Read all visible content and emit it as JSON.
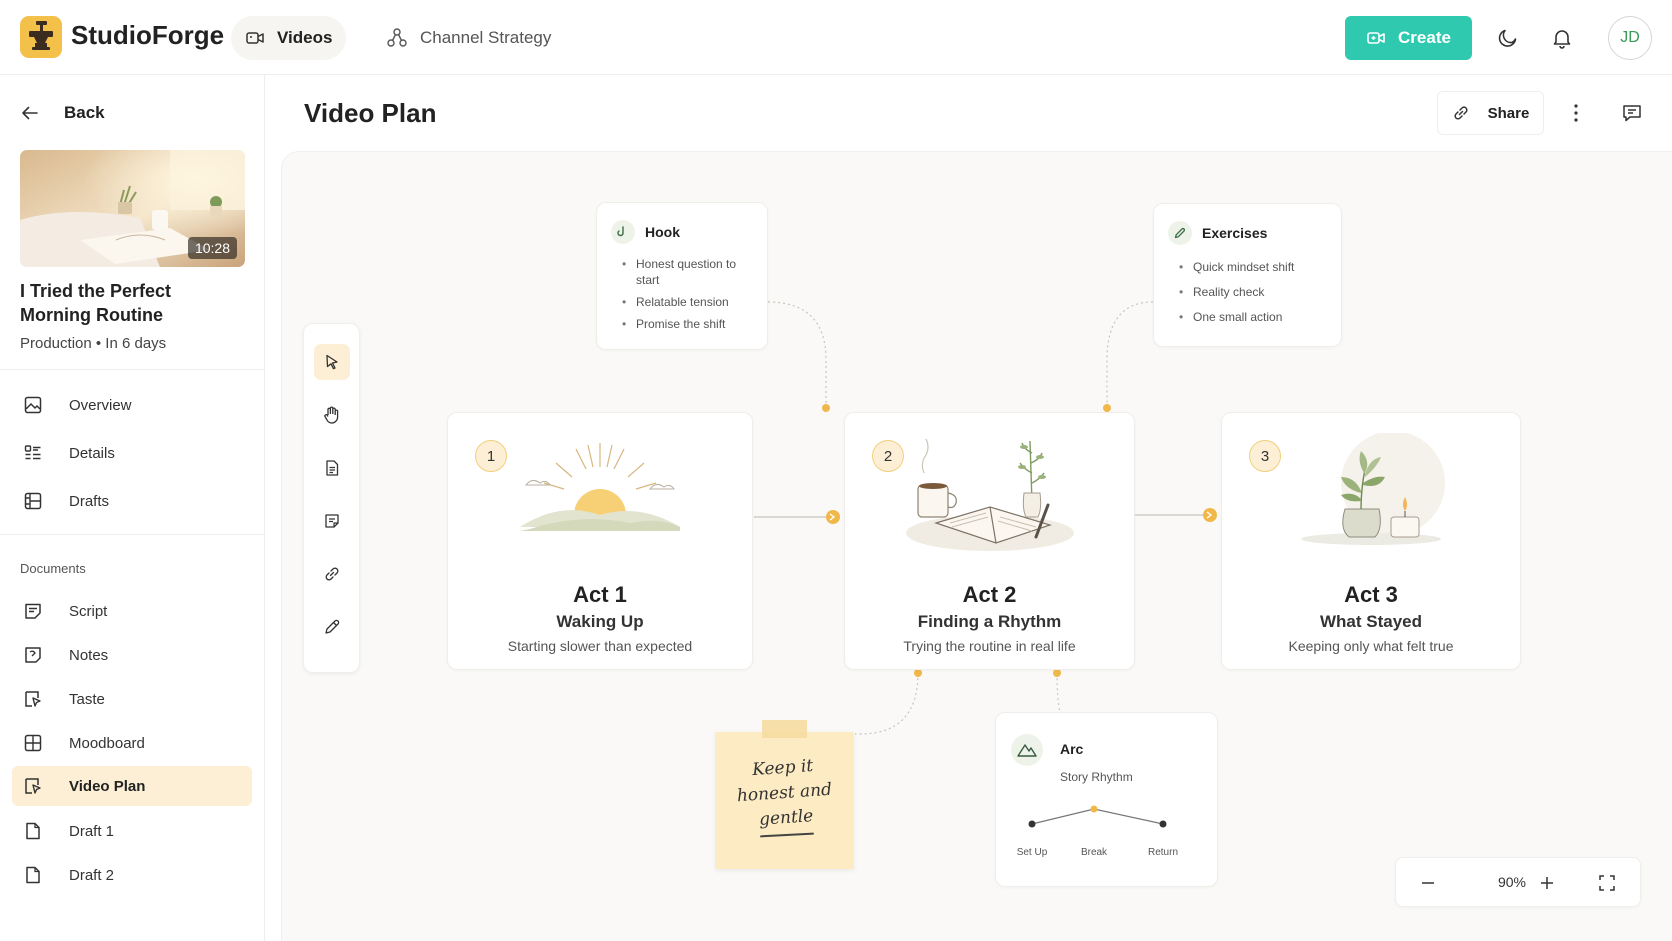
{
  "app": {
    "name": "StudioForge"
  },
  "topnav": {
    "tabs": [
      {
        "label": "Videos",
        "icon": "video-icon"
      },
      {
        "label": "Channel Strategy",
        "icon": "nodes-icon"
      }
    ],
    "create_label": "Create",
    "avatar_initials": "JD"
  },
  "sidebar": {
    "back_label": "Back",
    "video": {
      "title": "I Tried the Perfect Morning Routine",
      "status": "Production • In 6 days",
      "duration": "10:28"
    },
    "main_items": [
      {
        "label": "Overview",
        "icon": "image-icon"
      },
      {
        "label": "Details",
        "icon": "list-icon"
      },
      {
        "label": "Drafts",
        "icon": "film-icon"
      }
    ],
    "documents_label": "Documents",
    "documents": [
      {
        "label": "Script",
        "icon": "script-icon"
      },
      {
        "label": "Notes",
        "icon": "notes-icon"
      },
      {
        "label": "Taste",
        "icon": "taste-icon"
      },
      {
        "label": "Moodboard",
        "icon": "grid-icon"
      },
      {
        "label": "Video Plan",
        "icon": "plan-icon",
        "active": true
      },
      {
        "label": "Draft 1",
        "icon": "file-icon"
      },
      {
        "label": "Draft 2",
        "icon": "file-icon"
      }
    ]
  },
  "main": {
    "title": "Video Plan",
    "share_label": "Share"
  },
  "canvas": {
    "hook": {
      "title": "Hook",
      "items": [
        "Honest question to start",
        "Relatable tension",
        "Promise the shift"
      ]
    },
    "exercises": {
      "title": "Exercises",
      "items": [
        "Quick mindset shift",
        "Reality check",
        "One small action"
      ]
    },
    "acts": [
      {
        "num": "1",
        "title": "Act 1",
        "subtitle": "Waking Up",
        "desc": "Starting slower than expected"
      },
      {
        "num": "2",
        "title": "Act 2",
        "subtitle": "Finding a Rhythm",
        "desc": "Trying the routine in real life"
      },
      {
        "num": "3",
        "title": "Act 3",
        "subtitle": "What Stayed",
        "desc": "Keeping only what felt true"
      }
    ],
    "sticky": {
      "line1": "Keep it",
      "line2": "honest and",
      "line3": "gentle"
    },
    "arc": {
      "title": "Arc",
      "subtitle": "Story Rhythm",
      "points": [
        "Set Up",
        "Break",
        "Return"
      ],
      "levels": [
        0.3,
        0.8,
        0.3
      ]
    },
    "zoom": "90%"
  },
  "colors": {
    "accent": "#2fc9b0",
    "highlight": "#fcefd6",
    "connector": "#f0b84a"
  }
}
